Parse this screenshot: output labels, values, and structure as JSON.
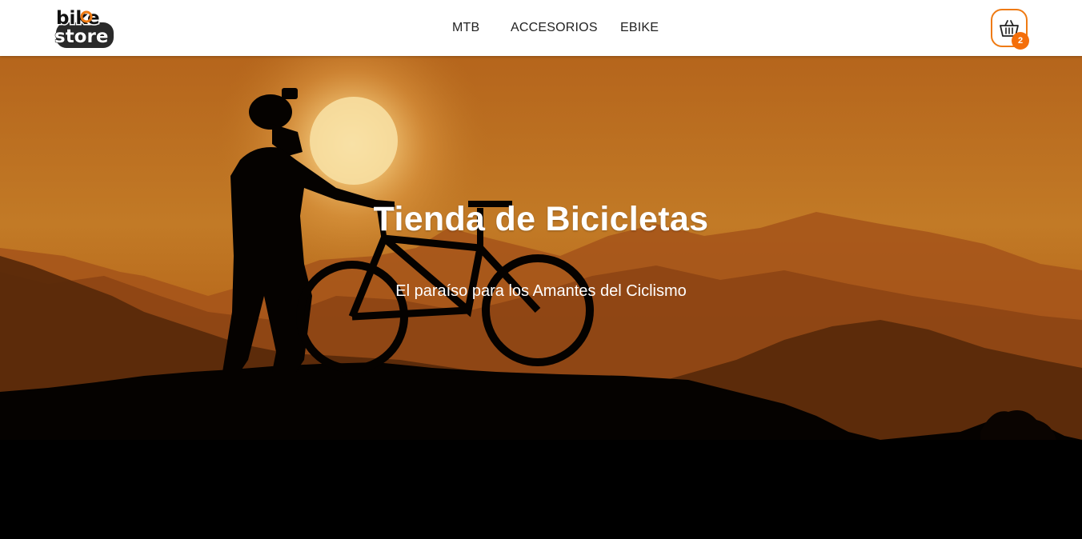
{
  "brand": {
    "logo_top": "bike",
    "logo_bottom": "store",
    "accent_color": "#ef7a12"
  },
  "nav": {
    "items": [
      {
        "label": "MTB"
      },
      {
        "label": "ACCESORIOS"
      },
      {
        "label": "EBIKE"
      }
    ]
  },
  "cart": {
    "icon": "basket-icon",
    "count": "2"
  },
  "hero": {
    "title": "Tienda de Bicicletas",
    "subtitle": "El paraíso para los Amantes del Ciclismo",
    "image": "cyclist-silhouette-sunset"
  }
}
